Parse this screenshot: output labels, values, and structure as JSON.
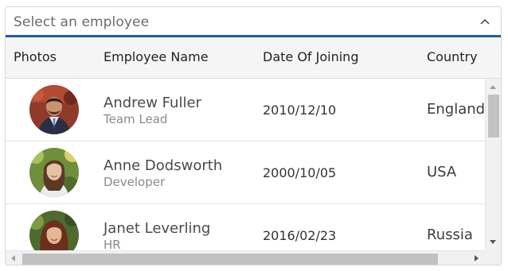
{
  "dropdown": {
    "placeholder": "Select an employee",
    "toggle_icon": "chevron-up-icon",
    "accent_color": "#1a5fb4"
  },
  "grid": {
    "columns": [
      "Photos",
      "Employee Name",
      "Date Of Joining",
      "Country"
    ],
    "rows": [
      {
        "photo_icon": "avatar-photo-andrew",
        "name": "Andrew Fuller",
        "designation": "Team Lead",
        "date": "2010/12/10",
        "country": "England"
      },
      {
        "photo_icon": "avatar-photo-anne",
        "name": "Anne Dodsworth",
        "designation": "Developer",
        "date": "2000/10/05",
        "country": "USA"
      },
      {
        "photo_icon": "avatar-photo-janet",
        "name": "Janet Leverling",
        "designation": "HR",
        "date": "2016/02/23",
        "country": "Russia"
      }
    ]
  },
  "colors": {
    "header_bg": "#f5f5f5",
    "row_border": "#e3e3e3",
    "scrollbar_thumb": "#c1c1c1"
  }
}
